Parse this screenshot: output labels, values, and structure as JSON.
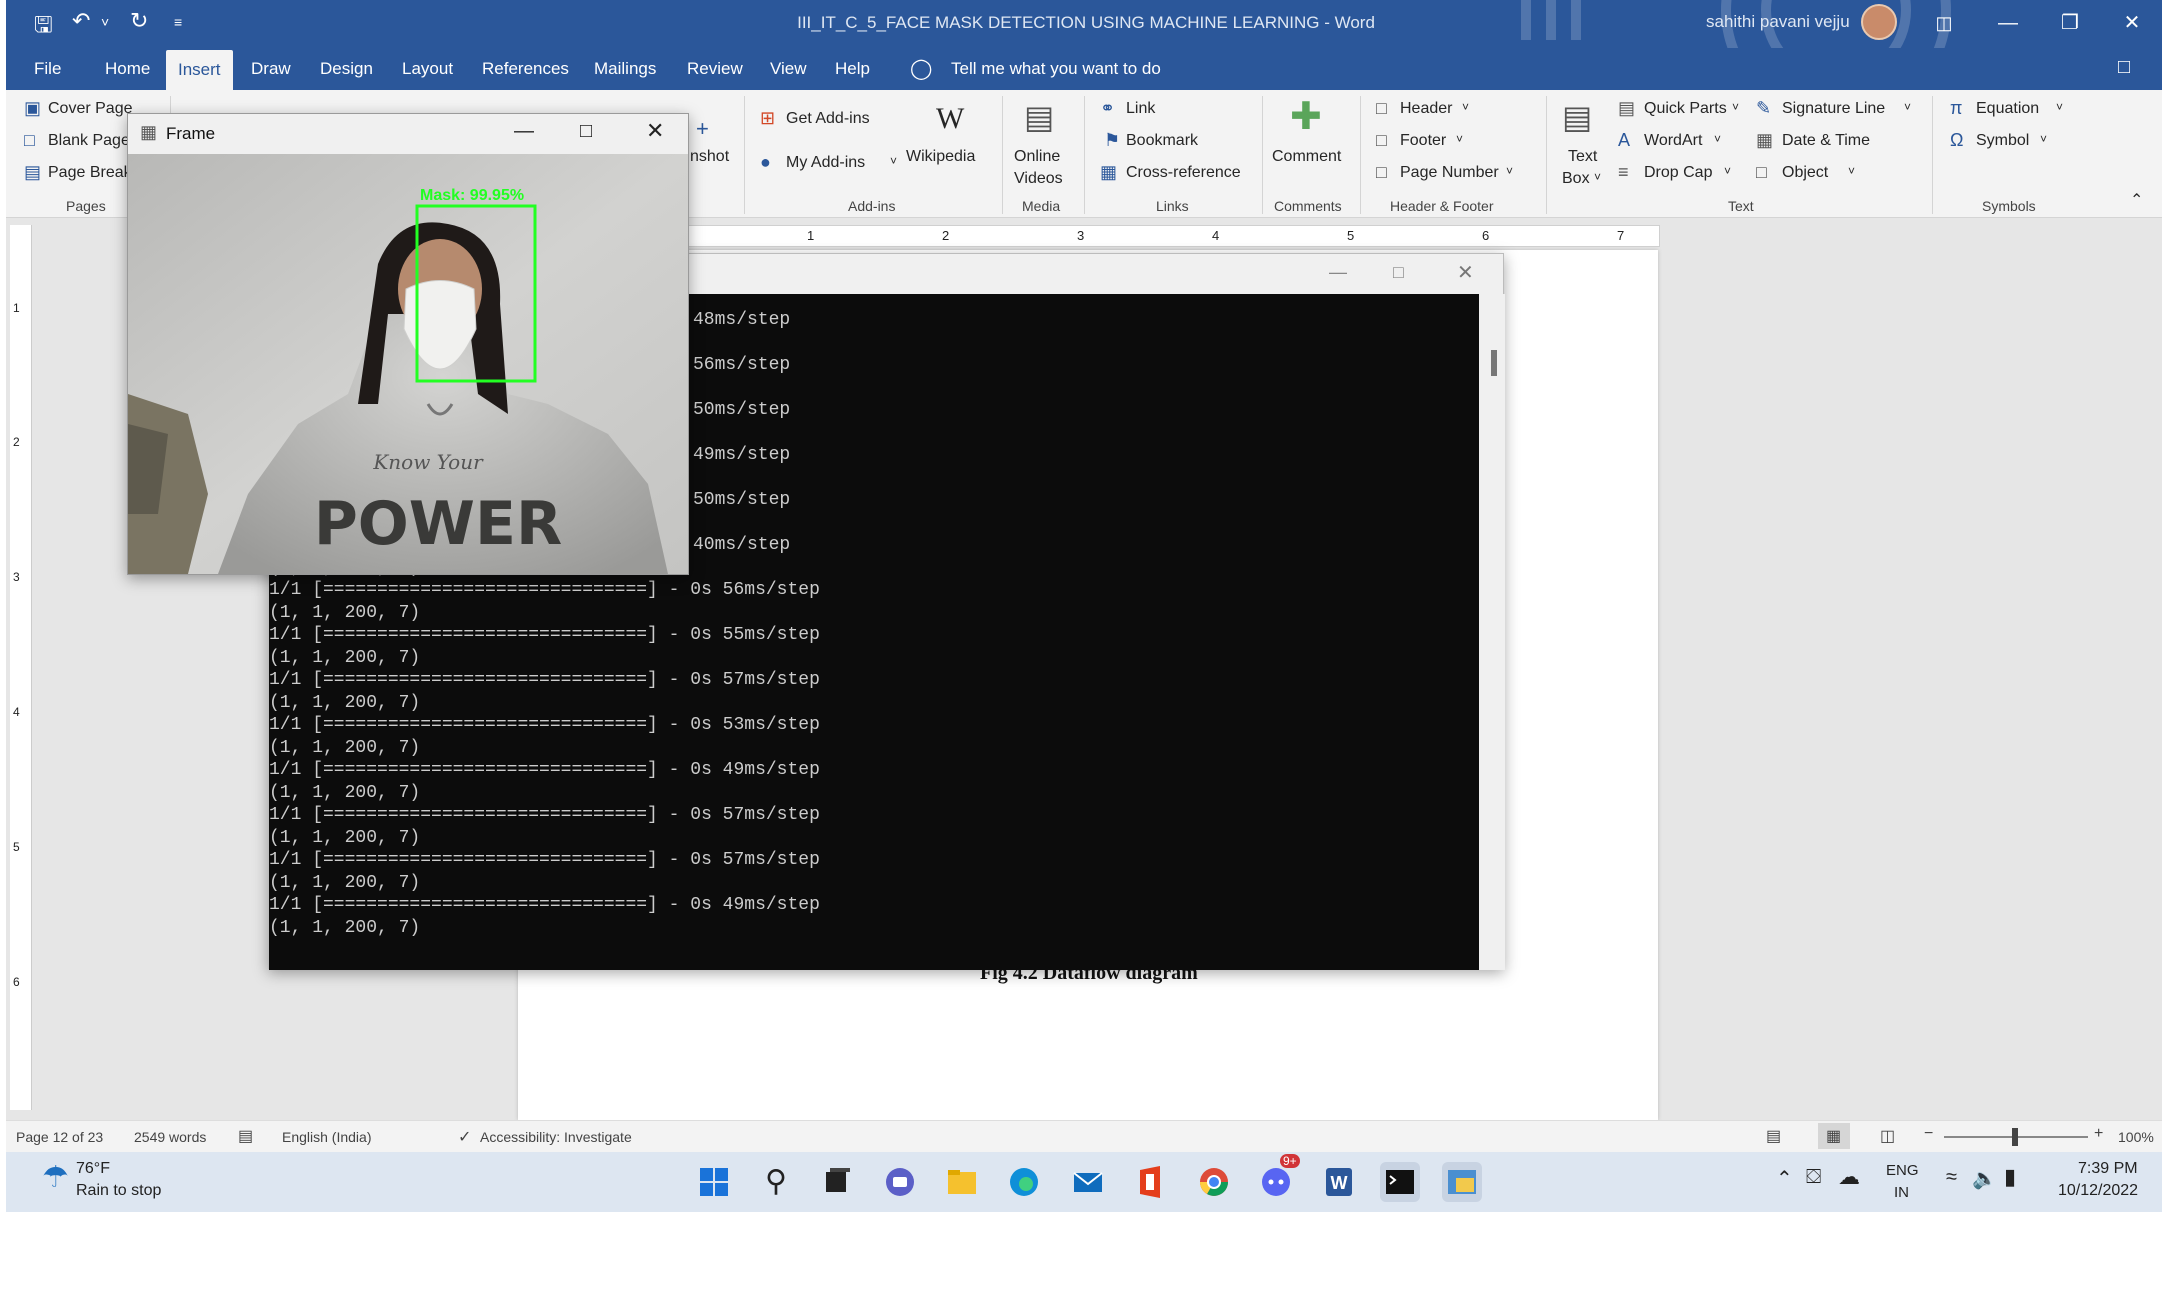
{
  "title_bar": {
    "document_title": "III_IT_C_5_FACE MASK DETECTION USING MACHINE LEARNING  -  Word",
    "user_name": "sahithi pavani vejju"
  },
  "menu": {
    "tabs": [
      "File",
      "Home",
      "Insert",
      "Draw",
      "Design",
      "Layout",
      "References",
      "Mailings",
      "Review",
      "View",
      "Help"
    ],
    "tell_me": "Tell me what you want to do"
  },
  "ribbon": {
    "pages": {
      "cover_page": "Cover Page",
      "blank_page": "Blank Page",
      "page_break": "Page Break",
      "group": "Pages"
    },
    "screenshot_partial": "nshot",
    "addins": {
      "get": "Get Add-ins",
      "my": "My Add-ins",
      "wikipedia": "Wikipedia",
      "group": "Add-ins"
    },
    "media": {
      "online_videos_1": "Online",
      "online_videos_2": "Videos",
      "group": "Media"
    },
    "links": {
      "link": "Link",
      "bookmark": "Bookmark",
      "cross_reference": "Cross-reference",
      "group": "Links"
    },
    "comments": {
      "comment": "Comment",
      "group": "Comments"
    },
    "header_footer": {
      "header": "Header",
      "footer": "Footer",
      "page_number": "Page Number",
      "group": "Header & Footer"
    },
    "text": {
      "text_box_1": "Text",
      "text_box_2": "Box",
      "quick_parts": "Quick Parts",
      "wordart": "WordArt",
      "drop_cap": "Drop Cap",
      "signature_line": "Signature Line",
      "date_time": "Date & Time",
      "object": "Object",
      "group": "Text"
    },
    "symbols": {
      "equation": "Equation",
      "symbol": "Symbol",
      "group": "Symbols"
    }
  },
  "ruler": {
    "marks": [
      "1",
      "2",
      "3",
      "4",
      "5",
      "6",
      "7"
    ],
    "v_marks": [
      "1",
      "2",
      "3",
      "4",
      "5",
      "6"
    ]
  },
  "frame_window": {
    "title": "Frame",
    "detection_label": "Mask: 99.95%",
    "shirt_text": "POWER",
    "shirt_script": "Know Your"
  },
  "console": {
    "lines": [
      "48ms/step",
      "56ms/step",
      "50ms/step",
      "49ms/step",
      "50ms/step",
      "40ms/step",
      "(1, 1, 200, 7)",
      "1/1 [==============================] - 0s 56ms/step",
      "(1, 1, 200, 7)",
      "1/1 [==============================] - 0s 55ms/step",
      "(1, 1, 200, 7)",
      "1/1 [==============================] - 0s 57ms/step",
      "(1, 1, 200, 7)",
      "1/1 [==============================] - 0s 53ms/step",
      "(1, 1, 200, 7)",
      "1/1 [==============================] - 0s 49ms/step",
      "(1, 1, 200, 7)",
      "1/1 [==============================] - 0s 57ms/step",
      "(1, 1, 200, 7)",
      "1/1 [==============================] - 0s 57ms/step",
      "(1, 1, 200, 7)",
      "1/1 [==============================] - 0s 49ms/step",
      "(1, 1, 200, 7)"
    ]
  },
  "document": {
    "caption": "Fig 4.2 Dataflow diagram"
  },
  "status_bar": {
    "page": "Page 12 of 23",
    "words": "2549 words",
    "language": "English (India)",
    "accessibility": "Accessibility: Investigate",
    "zoom": "100%",
    "zoom_level": 1.0
  },
  "taskbar": {
    "weather_temp": "76°F",
    "weather_desc": "Rain to stop",
    "lang_1": "ENG",
    "lang_2": "IN",
    "time": "7:39 PM",
    "date": "10/12/2022",
    "chat_badge": "9+"
  },
  "colors": {
    "word_blue": "#2b579a",
    "ribbon_bg": "#f3f3f3",
    "console_bg": "#0c0c0c",
    "detection_green": "#22ff22"
  }
}
